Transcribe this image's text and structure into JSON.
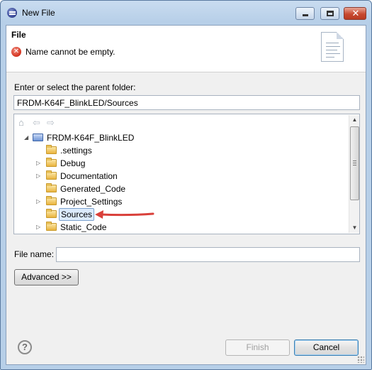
{
  "window": {
    "title": "New File",
    "title_icon": "eclipse-icon",
    "controls": {
      "minimize": "minimize-icon",
      "maximize": "maximize-icon",
      "close": "✕"
    }
  },
  "header": {
    "title": "File",
    "message": "Name cannot be empty.",
    "message_icon": "error-icon",
    "message_icon_glyph": "✕",
    "wizard_icon": "document-icon"
  },
  "parent_folder": {
    "label": "Enter or select the parent folder:",
    "value": "FRDM-K64F_BlinkLED/Sources"
  },
  "tree_toolbar": {
    "home": "⌂",
    "back": "⇦",
    "forward": "⇨"
  },
  "tree": {
    "root": {
      "label": "FRDM-K64F_BlinkLED",
      "expanded": true,
      "twisty": "◢"
    },
    "children": [
      {
        "label": ".settings",
        "expandable": false,
        "twisty": ""
      },
      {
        "label": "Debug",
        "expandable": true,
        "twisty": "▷"
      },
      {
        "label": "Documentation",
        "expandable": true,
        "twisty": "▷"
      },
      {
        "label": "Generated_Code",
        "expandable": false,
        "twisty": ""
      },
      {
        "label": "Project_Settings",
        "expandable": true,
        "twisty": "▷"
      },
      {
        "label": "Sources",
        "expandable": false,
        "twisty": "",
        "selected": true
      },
      {
        "label": "Static_Code",
        "expandable": true,
        "twisty": "▷"
      }
    ]
  },
  "scrollbar": {
    "up": "▲",
    "down": "▼"
  },
  "annotation": {
    "color": "#d9403a"
  },
  "file_name": {
    "label": "File name:",
    "value": ""
  },
  "buttons": {
    "advanced": "Advanced >>",
    "finish": "Finish",
    "cancel": "Cancel",
    "help": "?"
  },
  "colors": {
    "selection": "#dcebfc",
    "error": "#d4321e",
    "arrow": "#d9403a"
  }
}
